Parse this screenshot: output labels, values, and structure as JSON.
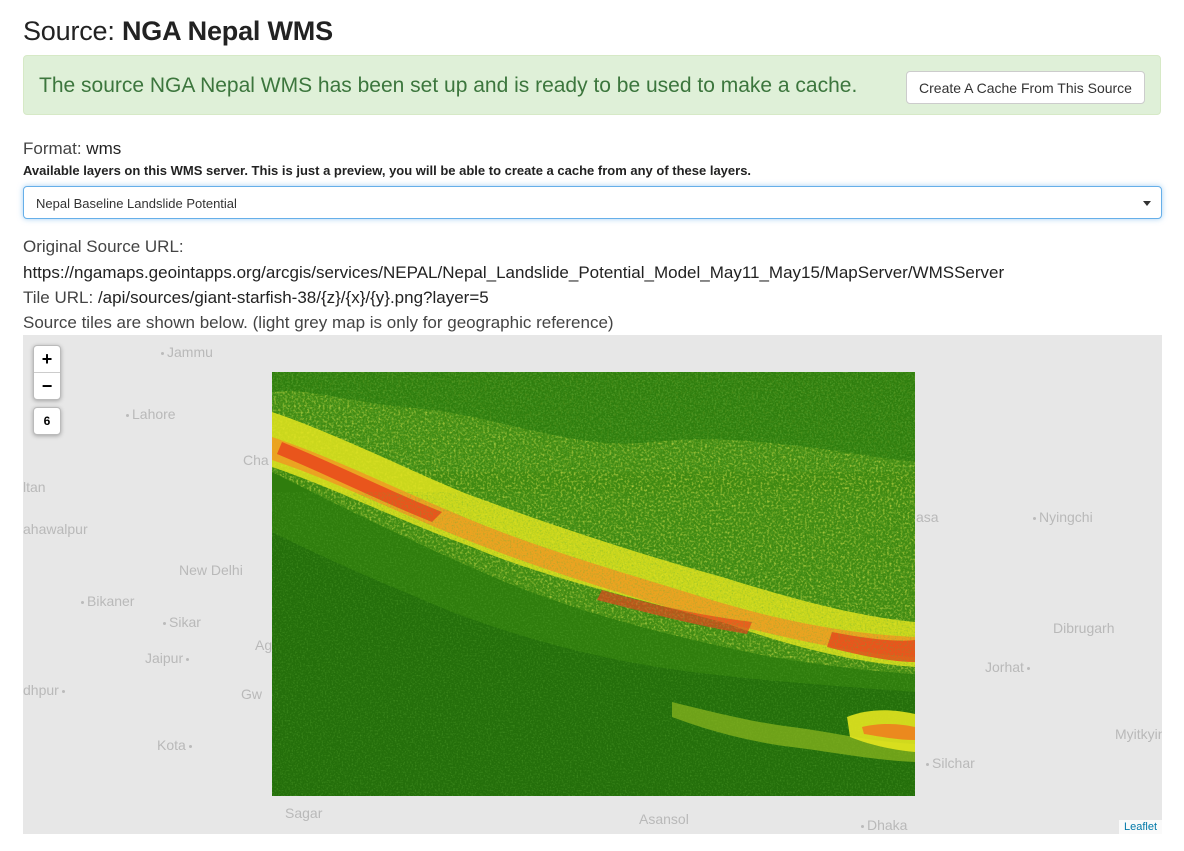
{
  "header": {
    "title_prefix": "Source:",
    "source_name": "NGA Nepal WMS"
  },
  "alert": {
    "message": "The source NGA Nepal WMS has been set up and is ready to be used to make a cache.",
    "button_label": "Create A Cache From This Source"
  },
  "format": {
    "label": "Format:",
    "value": "wms"
  },
  "layers_hint": "Available layers on this WMS server. This is just a preview, you will be able to create a cache from any of these layers.",
  "layer_select": {
    "selected": "Nepal Baseline Landslide Potential"
  },
  "original_url": {
    "label": "Original Source URL:",
    "value": "https://ngamaps.geointapps.org/arcgis/services/NEPAL/Nepal_Landslide_Potential_Model_May11_May15/MapServer/WMSServer"
  },
  "tile_url": {
    "label": "Tile URL:",
    "value": "/api/sources/giant-starfish-38/{z}/{x}/{y}.png?layer=5"
  },
  "map_note": "Source tiles are shown below. (light grey map is only for geographic reference)",
  "map": {
    "zoom_in": "+",
    "zoom_out": "−",
    "zoom_level": "6",
    "attribution": "Leaflet",
    "cities": [
      {
        "name": "Jammu"
      },
      {
        "name": "Lahore"
      },
      {
        "name": "Cha"
      },
      {
        "name": "ltan"
      },
      {
        "name": "ahawalpur"
      },
      {
        "name": "New Delhi"
      },
      {
        "name": "Bikaner"
      },
      {
        "name": "Sikar"
      },
      {
        "name": "Jaipur"
      },
      {
        "name": "Ag"
      },
      {
        "name": "dhpur"
      },
      {
        "name": "Gw"
      },
      {
        "name": "Kota"
      },
      {
        "name": "Sagar"
      },
      {
        "name": "Asansol"
      },
      {
        "name": "Dhaka"
      },
      {
        "name": "Silchar"
      },
      {
        "name": "Myitkyin"
      },
      {
        "name": "Jorhat"
      },
      {
        "name": "Dibrugarh"
      },
      {
        "name": "Nyingchi"
      },
      {
        "name": "asa"
      }
    ],
    "overlay_colors": [
      "#1f6e0a",
      "#3f8a12",
      "#8fb820",
      "#d7e21e",
      "#f3c521",
      "#f07a1f",
      "#e8411c"
    ]
  }
}
